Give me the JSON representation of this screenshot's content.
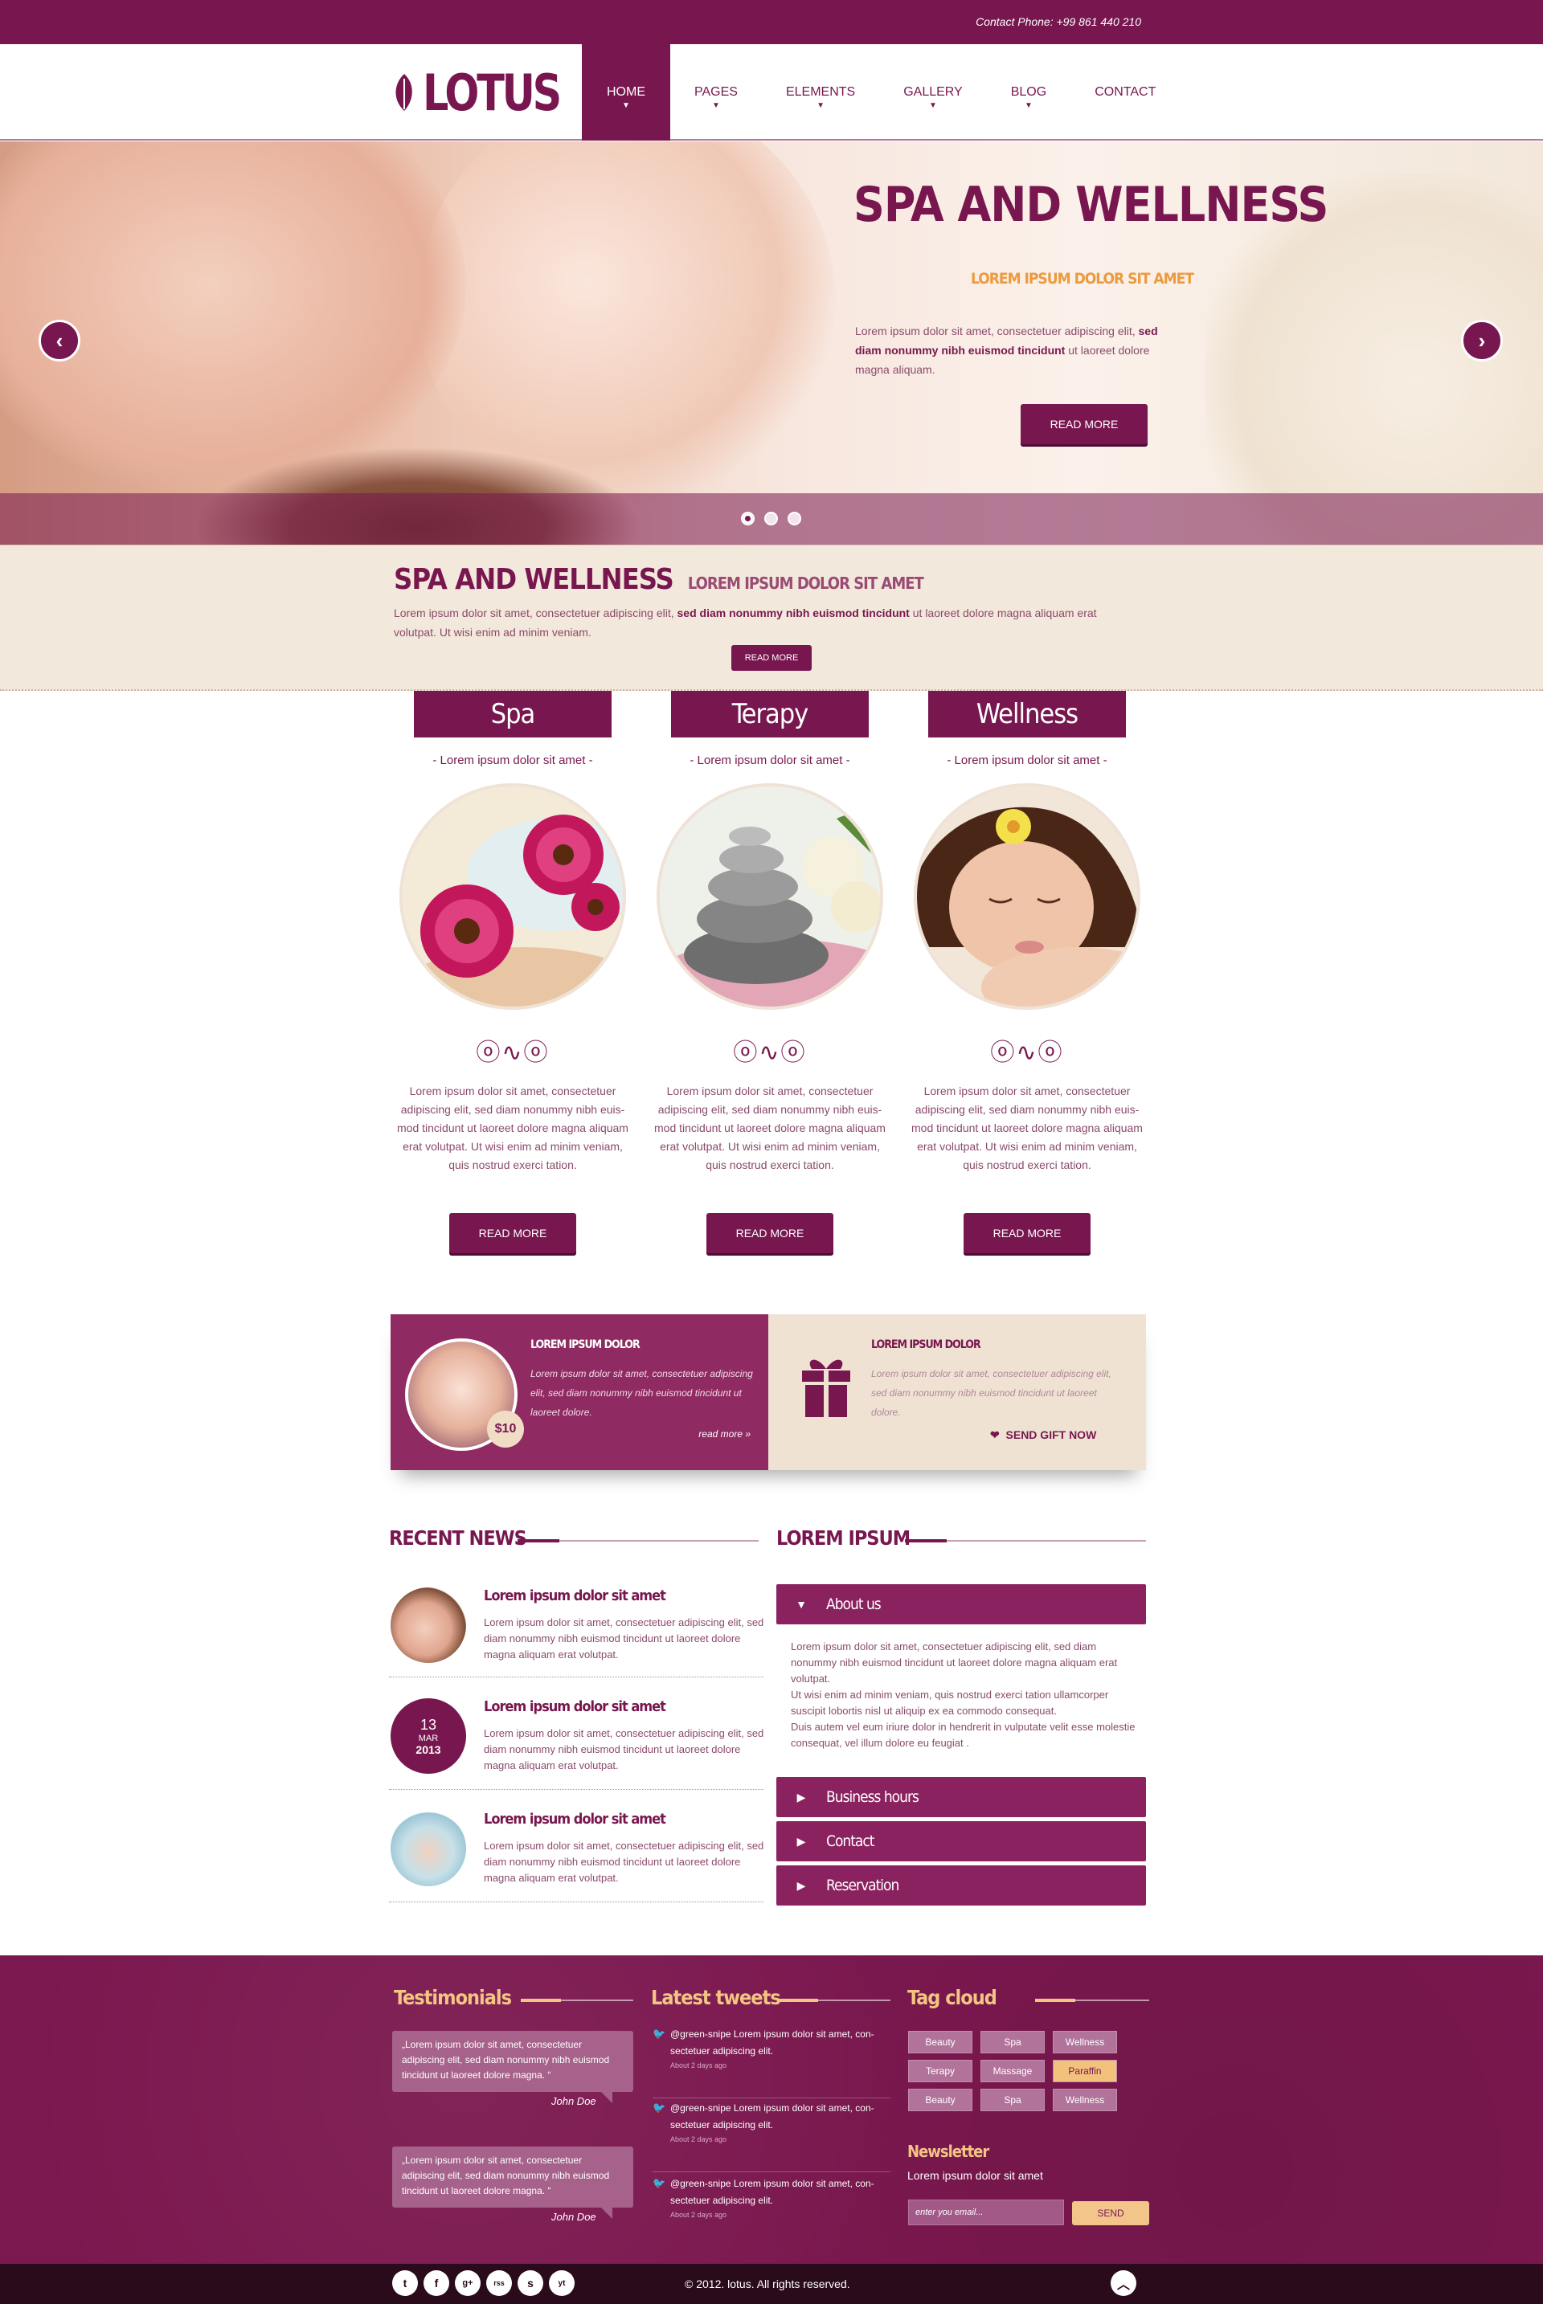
{
  "topbar": {
    "phone": "Contact Phone: +99 861 440 210"
  },
  "logo": {
    "text": "LOTUS"
  },
  "nav": [
    {
      "label": "HOME",
      "active": true,
      "caret": "▼"
    },
    {
      "label": "PAGES",
      "caret": "▼"
    },
    {
      "label": "ELEMENTS",
      "caret": "▼"
    },
    {
      "label": "GALLERY",
      "caret": "▼"
    },
    {
      "label": "BLOG",
      "caret": "▼"
    },
    {
      "label": "CONTACT",
      "caret": ""
    }
  ],
  "hero": {
    "title": "SPA AND WELLNESS",
    "subtitle": "LOREM IPSUM DOLOR SIT AMET",
    "text_a": "Lorem ipsum dolor sit amet, consectetuer adipiscing elit, ",
    "text_bold": "sed diam nonummy nibh euismod tincidunt",
    "text_b": " ut laoreet dolore magna aliquam.",
    "button": "READ MORE",
    "prev": "‹",
    "next": "›",
    "slides": 3,
    "current_slide": 1
  },
  "intro": {
    "title": "SPA AND WELLNESS",
    "subtitle": "LOREM IPSUM DOLOR SIT AMET",
    "text_a": "Lorem ipsum dolor sit amet, consectetuer adipiscing elit, ",
    "text_bold": "sed diam nonummy nibh euismod tincidunt",
    "text_b": " ut laoreet dolore magna aliquam erat volutpat. Ut wisi enim ad minim veniam.",
    "button": "READ MORE"
  },
  "services": [
    {
      "title": "Spa",
      "sub": "- Lorem ipsum dolor sit amet -",
      "ornament": "ⓞ∿ⓞ",
      "text": "Lorem ipsum dolor sit amet, consectetuer adipiscing elit, sed diam nonummy nibh euis-mod tincidunt ut laoreet dolore magna aliquam erat volutpat. Ut wisi enim ad minim veniam, quis nostrud exerci tation.",
      "button": "READ MORE"
    },
    {
      "title": "Terapy",
      "sub": "- Lorem ipsum dolor sit amet -",
      "ornament": "ⓞ∿ⓞ",
      "text": "Lorem ipsum dolor sit amet, consectetuer adipiscing elit, sed diam nonummy nibh euis-mod tincidunt ut laoreet dolore magna aliquam erat volutpat. Ut wisi enim ad minim veniam, quis nostrud exerci tation.",
      "button": "READ MORE"
    },
    {
      "title": "Wellness",
      "sub": "- Lorem ipsum dolor sit amet -",
      "ornament": "ⓞ∿ⓞ",
      "text": "Lorem ipsum dolor sit amet, consectetuer adipiscing elit, sed diam nonummy nibh euis-mod tincidunt ut laoreet dolore magna aliquam erat volutpat. Ut wisi enim ad minim veniam, quis nostrud exerci tation.",
      "button": "READ MORE"
    }
  ],
  "promo": {
    "left_title": "LOREM IPSUM DOLOR",
    "left_text": "Lorem ipsum dolor sit amet, consectetuer adipiscing elit, sed diam nonummy nibh euismod tincidunt ut laoreet dolore.",
    "price": "$10",
    "left_link": "read more »",
    "right_title": "LOREM IPSUM DOLOR",
    "right_text": "Lorem ipsum dolor sit amet, consectetuer adipiscing elit, sed diam nonummy nibh euismod tincidunt ut laoreet dolore.",
    "right_link": "SEND GIFT NOW",
    "heart": "❤"
  },
  "news": {
    "heading": "RECENT NEWS",
    "items": [
      {
        "title": "Lorem ipsum dolor sit amet",
        "text": "Lorem ipsum dolor sit amet, consectetuer adipiscing elit, sed diam nonummy nibh euismod tincidunt ut laoreet dolore magna aliquam erat volutpat."
      },
      {
        "title": "Lorem ipsum dolor sit amet",
        "text": "Lorem ipsum dolor sit amet, consectetuer adipiscing elit, sed diam nonummy nibh euismod tincidunt ut laoreet dolore magna aliquam erat volutpat.",
        "day": "13",
        "month": "MAR",
        "year": "2013"
      },
      {
        "title": "Lorem ipsum dolor sit amet",
        "text": "Lorem ipsum dolor sit amet, consectetuer adipiscing elit, sed diam nonummy nibh euismod tincidunt ut laoreet dolore magna aliquam erat volutpat."
      }
    ]
  },
  "accordion": {
    "heading": "LOREM IPSUM",
    "open_icon": "▼",
    "closed_icon": "▶",
    "items": [
      "About us",
      "Business hours",
      "Contact",
      "Reservation"
    ],
    "body": "Lorem ipsum dolor sit amet, consectetuer adipiscing elit, sed diam nonummy nibh euismod tincidunt ut laoreet dolore magna aliquam erat volutpat.\nUt wisi enim ad minim veniam, quis nostrud exerci tation ullamcorper suscipit lobortis nisl ut aliquip ex ea commodo consequat.\nDuis autem vel eum iriure dolor in hendrerit in vulputate velit esse molestie consequat, vel illum dolore eu feugiat ."
  },
  "footer": {
    "testimonials_title": "Testimonials",
    "testimonials": [
      {
        "quote": "„Lorem ipsum dolor sit amet, consectetuer adipiscing elit, sed diam nonummy nibh euismod tincidunt ut laoreet dolore magna. “",
        "author": "John Doe"
      },
      {
        "quote": "„Lorem ipsum dolor sit amet, consectetuer adipiscing elit, sed diam nonummy nibh euismod tincidunt ut laoreet dolore magna. “",
        "author": "John Doe"
      }
    ],
    "tweets_title": "Latest tweets",
    "tweet_icon": "🐦",
    "tweets": [
      {
        "text": "@green-snipe Lorem ipsum dolor sit amet, con-sectetuer adipiscing elit.",
        "ago": "About 2 days ago"
      },
      {
        "text": "@green-snipe Lorem ipsum dolor sit amet, con-sectetuer adipiscing elit.",
        "ago": "About 2 days ago"
      },
      {
        "text": "@green-snipe Lorem ipsum dolor sit amet, con-sectetuer adipiscing elit.",
        "ago": "About 2 days ago"
      }
    ],
    "tagcloud_title": "Tag cloud",
    "tags": [
      "Beauty",
      "Spa",
      "Wellness",
      "Terapy",
      "Massage",
      "Paraffin",
      "Beauty",
      "Spa",
      "Wellness"
    ],
    "highlighted_tag": "Paraffin",
    "newsletter_title": "Newsletter",
    "newsletter_sub": "Lorem ipsum dolor sit amet",
    "email_placeholder": "enter you email...",
    "send": "SEND"
  },
  "bottom": {
    "copyright": "© 2012. lotus. All rights reserved.",
    "social": [
      "t",
      "f",
      "g+",
      "rss",
      "s",
      "yt"
    ],
    "to_top": "︿"
  },
  "colors": {
    "brand": "#78174f",
    "accent": "#ec9a3e",
    "cream": "#f3e8dc"
  }
}
